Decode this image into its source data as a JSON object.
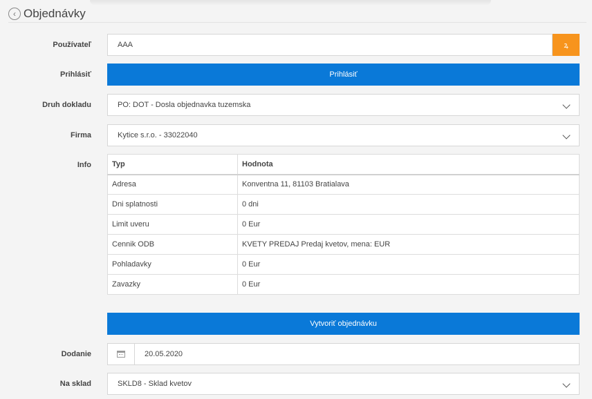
{
  "header": {
    "title": "Objednávky"
  },
  "user": {
    "label": "Používateľ",
    "value": "AAA",
    "button_icon": "user-search-icon",
    "button_glyph": "ꝝ"
  },
  "login": {
    "label": "Prihlásiť",
    "button_label": "Prihlásiť"
  },
  "doc_type": {
    "label": "Druh dokladu",
    "value": "PO: DOT - Dosla objednavka tuzemska"
  },
  "company": {
    "label": "Firma",
    "value": "Kytice s.r.o. - 33022040"
  },
  "info": {
    "label": "Info",
    "columns": [
      "Typ",
      "Hodnota"
    ],
    "rows": [
      [
        "Adresa",
        "Konventna 11, 81103 Bratialava"
      ],
      [
        "Dni splatnosti",
        "0 dni"
      ],
      [
        "Limit uveru",
        "0 Eur"
      ],
      [
        "Cennik ODB",
        "KVETY PREDAJ Predaj kvetov, mena: EUR"
      ],
      [
        "Pohladavky",
        "0 Eur"
      ],
      [
        "Zavazky",
        "0 Eur"
      ]
    ]
  },
  "create": {
    "button_label": "Vytvoriť objednávku"
  },
  "delivery": {
    "label": "Dodanie",
    "value": "20.05.2020"
  },
  "warehouse": {
    "label": "Na sklad",
    "value": "SKLD8 - Sklad kvetov"
  },
  "colors": {
    "accent_blue": "#0a79d8",
    "accent_orange": "#f7941d"
  }
}
